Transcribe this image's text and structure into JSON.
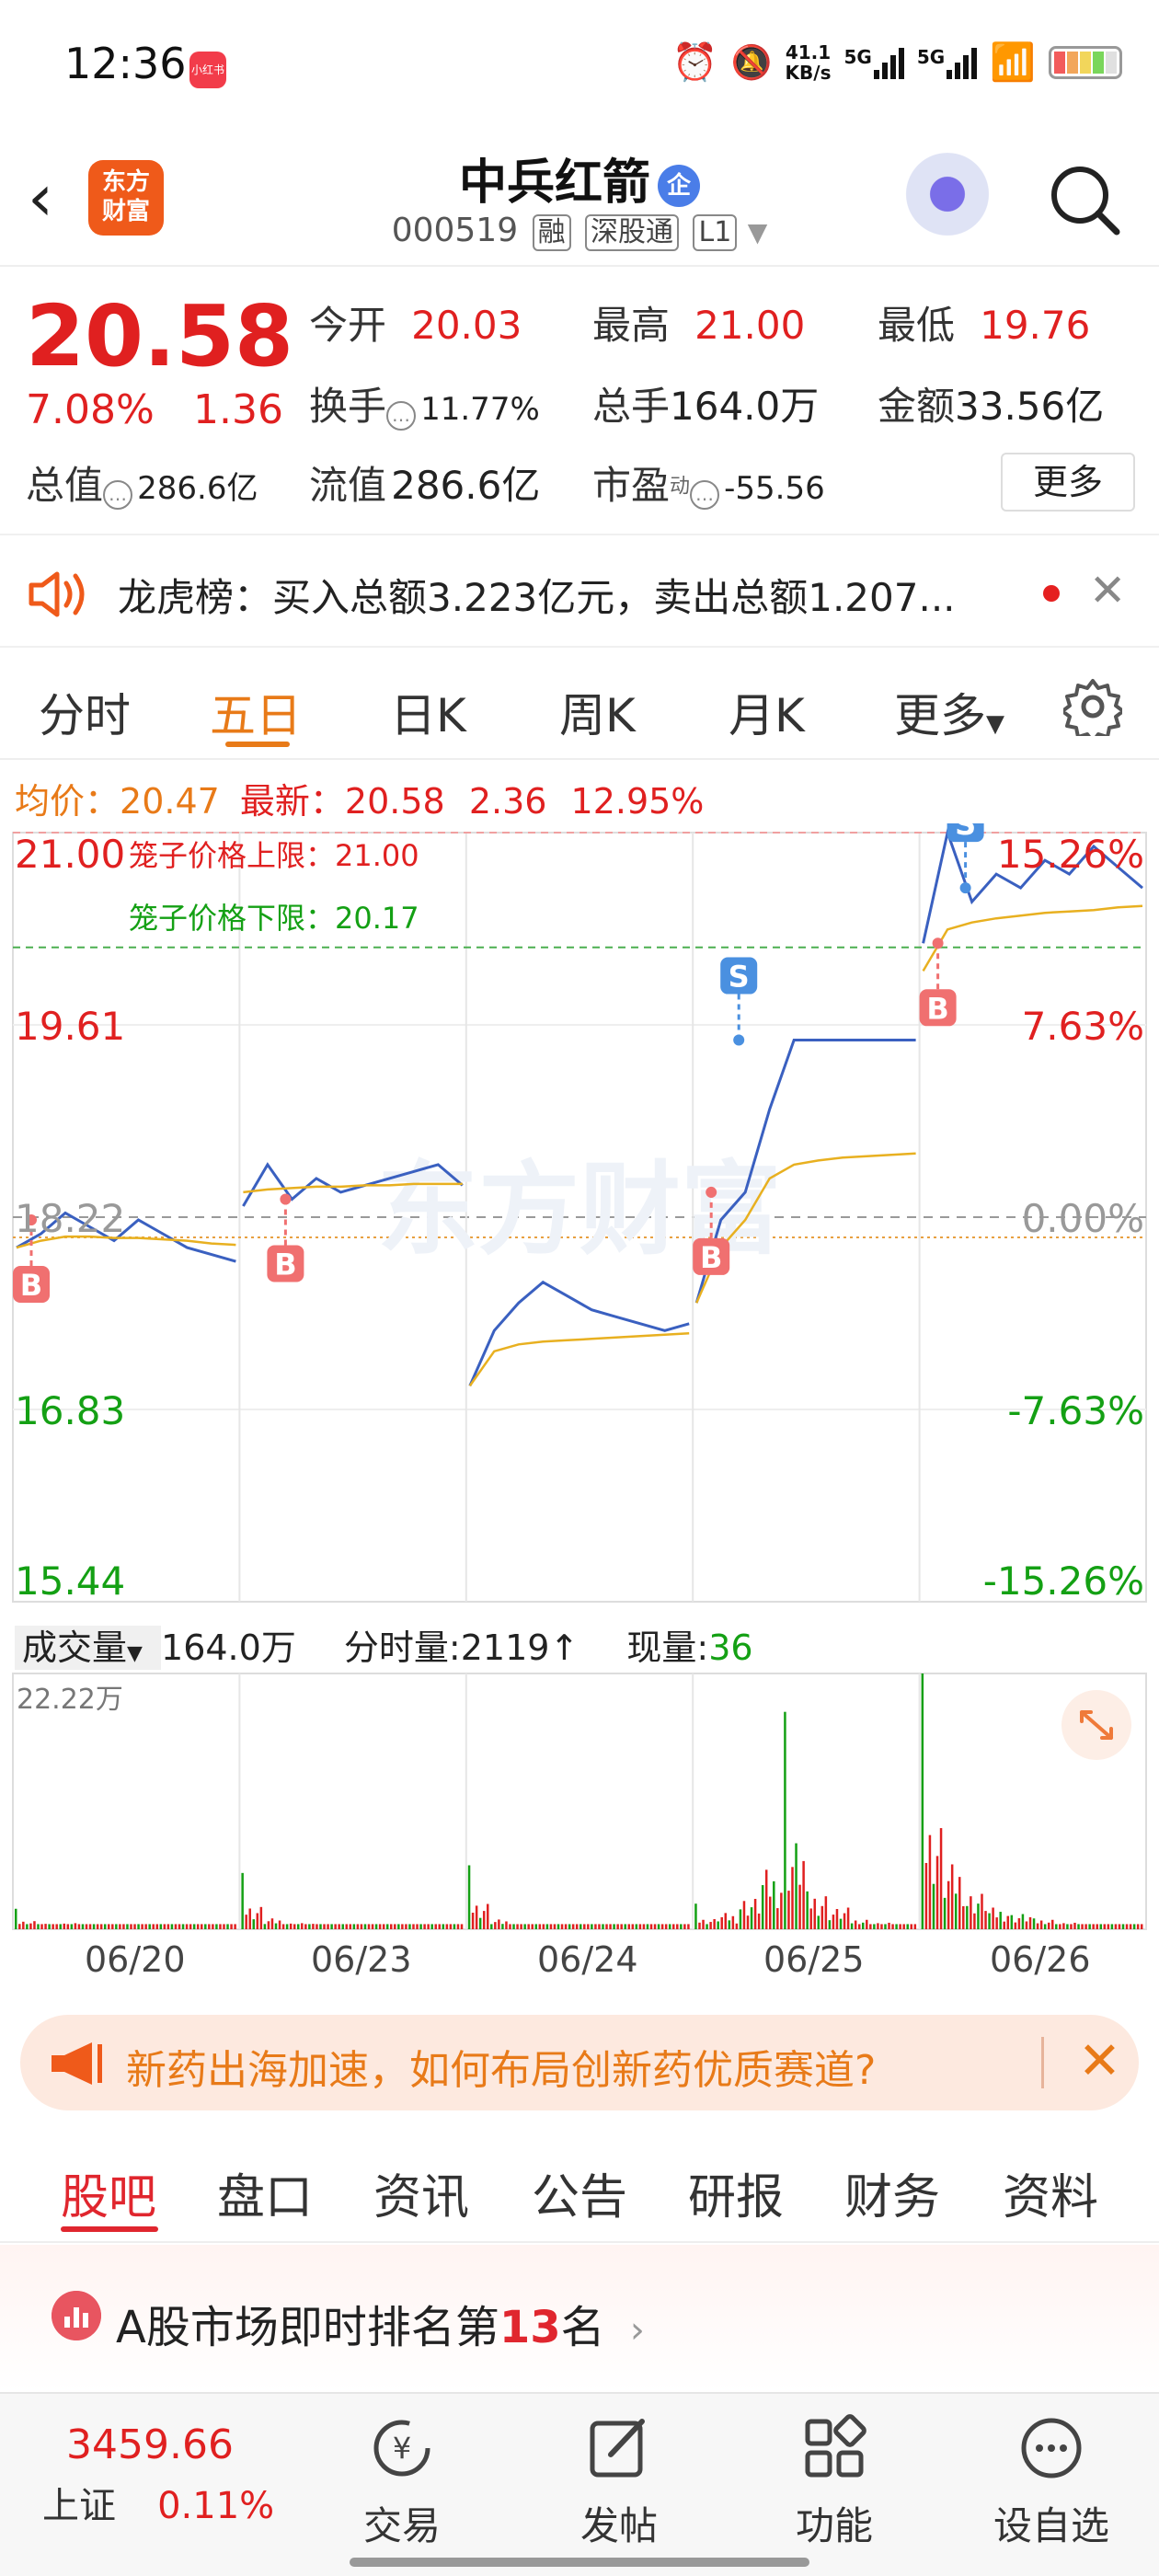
{
  "status_bar": {
    "time": "12:36",
    "app_badge": "小红书",
    "net_speed_top": "41.1",
    "net_speed_unit": "KB/s",
    "signal1": "5G",
    "signal2": "5G"
  },
  "header": {
    "stock_name": "中兵红箭",
    "name_badge": "企",
    "stock_code": "000519",
    "tags": [
      "融",
      "深股通",
      "L1"
    ],
    "logo_text_1": "东方",
    "logo_text_2": "财富"
  },
  "quote": {
    "price": "20.58",
    "change_pct": "7.08%",
    "change_amt": "1.36",
    "open_label": "今开",
    "open": "20.03",
    "high_label": "最高",
    "high": "21.00",
    "low_label": "最低",
    "low": "19.76",
    "turnover_label": "换手",
    "turnover": "11.77%",
    "volume_label": "总手",
    "volume": "164.0万",
    "amount_label": "金额",
    "amount": "33.56亿",
    "mktcap_label": "总值",
    "mktcap": "286.6亿",
    "float_label": "流值",
    "float": "286.6亿",
    "pe_label": "市盈",
    "pe_sup": "动",
    "pe": "-55.56",
    "more": "更多"
  },
  "notice": {
    "text": "龙虎榜：买入总额3.223亿元，卖出总额1.207..."
  },
  "chart_tabs": {
    "items": [
      "分时",
      "五日",
      "日K",
      "周K",
      "月K",
      "更多"
    ],
    "active": 1
  },
  "chart_stats": {
    "avg_label": "均价：",
    "avg": "20.47",
    "latest_label": "最新：",
    "latest": "20.58",
    "chg": "2.36",
    "pct": "12.95%"
  },
  "chart_data": {
    "type": "line",
    "title": "",
    "days": [
      "06/20",
      "06/23",
      "06/24",
      "06/25",
      "06/26"
    ],
    "y_ticks_left": [
      "21.00",
      "19.61",
      "18.22",
      "16.83",
      "15.44"
    ],
    "y_ticks_right": [
      "15.26%",
      "7.63%",
      "0.00%",
      "-7.63%",
      "-15.26%"
    ],
    "ylim": [
      15.44,
      21.0
    ],
    "prev_close": 18.22,
    "upper_limit_label": "笼子价格上限：21.00",
    "lower_limit_label": "笼子价格下限：20.17",
    "upper_limit": 21.0,
    "lower_limit": 20.17,
    "watermark": "东方财富",
    "series": [
      {
        "name": "price",
        "color": "#3a60c0",
        "values": [
          18.0,
          18.1,
          18.25,
          18.15,
          18.05,
          18.2,
          18.1,
          18.0,
          17.95,
          17.9,
          18.3,
          18.6,
          18.35,
          18.5,
          18.4,
          18.45,
          18.5,
          18.55,
          18.6,
          18.45,
          17.0,
          17.4,
          17.6,
          17.75,
          17.65,
          17.55,
          17.5,
          17.45,
          17.4,
          17.45,
          17.6,
          18.2,
          18.4,
          19.0,
          19.5,
          19.5,
          19.5,
          19.5,
          19.5,
          19.5,
          20.2,
          21.0,
          20.5,
          20.7,
          20.6,
          20.8,
          20.7,
          20.9,
          20.75,
          20.6
        ]
      },
      {
        "name": "avg",
        "color": "#e8b020",
        "values": [
          18.0,
          18.05,
          18.08,
          18.08,
          18.07,
          18.07,
          18.06,
          18.05,
          18.03,
          18.02,
          18.4,
          18.42,
          18.43,
          18.44,
          18.44,
          18.45,
          18.45,
          18.46,
          18.46,
          18.46,
          17.0,
          17.25,
          17.3,
          17.32,
          17.33,
          17.34,
          17.35,
          17.36,
          17.37,
          17.38,
          17.6,
          18.0,
          18.2,
          18.5,
          18.6,
          18.63,
          18.65,
          18.66,
          18.67,
          18.68,
          20.0,
          20.3,
          20.35,
          20.38,
          20.4,
          20.42,
          20.43,
          20.44,
          20.46,
          20.47
        ]
      }
    ],
    "markers": [
      {
        "type": "B",
        "day": 0,
        "value": 18.2
      },
      {
        "type": "B",
        "day": 1,
        "value": 18.35
      },
      {
        "type": "B",
        "day": 3,
        "value": 18.4
      },
      {
        "type": "S",
        "day": 3,
        "value": 19.5
      },
      {
        "type": "B",
        "day": 4,
        "value": 20.2
      },
      {
        "type": "S",
        "day": 4,
        "value": 20.6
      }
    ]
  },
  "volume": {
    "label": "成交量",
    "total": "164.0万",
    "minute_label": "分时量:",
    "minute": "2119",
    "now_label": "现量:",
    "now": "36",
    "y_max_label": "22.22万",
    "spikes": [
      {
        "day": 0,
        "peaks": [
          0.08,
          0.05,
          0.06,
          0.04,
          0.05,
          0.03,
          0.04,
          0.03,
          0.02,
          0.04
        ]
      },
      {
        "day": 1,
        "peaks": [
          0.22,
          0.1,
          0.06,
          0.05,
          0.04,
          0.03,
          0.03,
          0.02,
          0.03,
          0.05
        ]
      },
      {
        "day": 2,
        "peaks": [
          0.25,
          0.09,
          0.05,
          0.04,
          0.03,
          0.03,
          0.02,
          0.03,
          0.02,
          0.05
        ]
      },
      {
        "day": 3,
        "peaks": [
          0.1,
          0.15,
          0.3,
          0.55,
          0.85,
          0.35,
          0.2,
          0.1,
          0.06,
          0.05
        ]
      },
      {
        "day": 4,
        "peaks": [
          1.0,
          0.6,
          0.35,
          0.2,
          0.15,
          0.1,
          0.06,
          0.04,
          0.03,
          0.02
        ]
      }
    ]
  },
  "ad": {
    "text": "新药出海加速，如何布局创新药优质赛道?"
  },
  "sub_tabs": {
    "items": [
      "股吧",
      "盘口",
      "资讯",
      "公告",
      "研报",
      "财务",
      "资料"
    ],
    "active": 0
  },
  "rank": {
    "prefix": "A股市场即时排名第",
    "number": "13",
    "suffix": "名"
  },
  "bottom_nav": {
    "index_value": "3459.66",
    "index_name": "上证",
    "index_pct": "0.11%",
    "items": [
      "交易",
      "发帖",
      "功能",
      "设自选"
    ]
  }
}
